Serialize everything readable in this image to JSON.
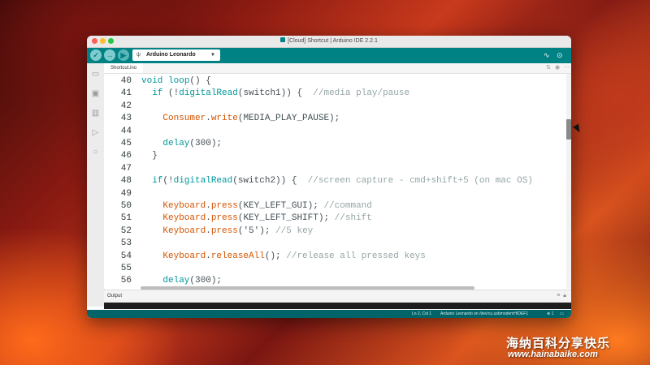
{
  "window": {
    "title": "[Cloud] Shortcut | Arduino IDE 2.2.1"
  },
  "toolbar": {
    "verify_icon": "check-icon",
    "upload_icon": "arrow-right-icon",
    "debug_icon": "debug-icon",
    "board_name": "Arduino Leonardo",
    "usb_icon": "usb-icon",
    "serial_plotter_icon": "pulse-icon",
    "serial_monitor_icon": "magnifier-gear-icon"
  },
  "sidebar": {
    "items": [
      "folder-icon",
      "board-manager-icon",
      "library-icon",
      "debug-icon",
      "search-icon"
    ]
  },
  "tab": {
    "label": "Shortcut.ino"
  },
  "code_lines": [
    {
      "number": "40",
      "text": "void loop() {"
    },
    {
      "number": "41",
      "text": "  if (!digitalRead(switch1)) {  //media play/pause"
    },
    {
      "number": "42",
      "text": ""
    },
    {
      "number": "43",
      "text": "    Consumer.write(MEDIA_PLAY_PAUSE);"
    },
    {
      "number": "44",
      "text": ""
    },
    {
      "number": "45",
      "text": "    delay(300);"
    },
    {
      "number": "46",
      "text": "  }"
    },
    {
      "number": "47",
      "text": ""
    },
    {
      "number": "48",
      "text": "  if(!digitalRead(switch2)) {  //screen capture - cmd+shift+5 (on mac OS)"
    },
    {
      "number": "49",
      "text": ""
    },
    {
      "number": "50",
      "text": "    Keyboard.press(KEY_LEFT_GUI); //command"
    },
    {
      "number": "51",
      "text": "    Keyboard.press(KEY_LEFT_SHIFT); //shift"
    },
    {
      "number": "52",
      "text": "    Keyboard.press('5'); //5 key"
    },
    {
      "number": "53",
      "text": ""
    },
    {
      "number": "54",
      "text": "    Keyboard.releaseAll(); //release all pressed keys"
    },
    {
      "number": "55",
      "text": ""
    },
    {
      "number": "56",
      "text": "    delay(300);"
    }
  ],
  "output": {
    "label": "Output"
  },
  "statusbar": {
    "position": "Ln 2, Col 1",
    "board": "Arduino Leonardo on /dev/cu.usbmodemHIDEF1",
    "notifications": "1"
  },
  "watermark": {
    "text": "海纳百科分享快乐",
    "url": "www.hainabaike.com"
  },
  "colors": {
    "accent": "#008184",
    "status_bar": "#006468",
    "keyword": "#00979c",
    "function": "#d35400",
    "comment": "#95a5a6"
  }
}
